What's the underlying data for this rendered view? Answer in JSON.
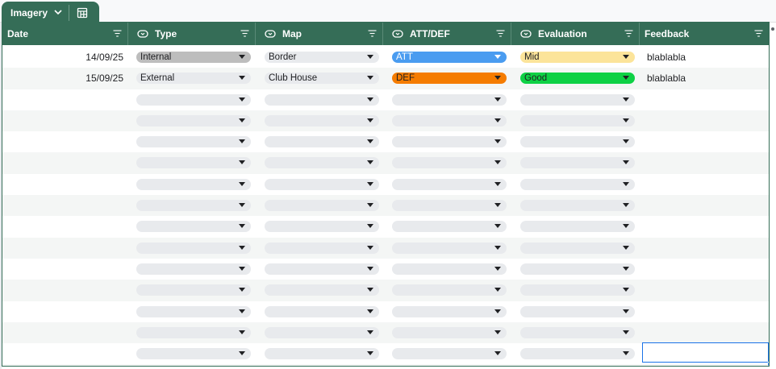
{
  "sheet_tab": {
    "name": "Imagery",
    "chevron_icon": "chevron-down-icon",
    "table_icon": "table-view-icon"
  },
  "colors": {
    "header_bg": "#356d57",
    "chip_default": "#e8eaed",
    "internal": "#bdbdbd",
    "att": "#4a9cf0",
    "def": "#f57c00",
    "mid": "#fce49a",
    "good": "#0ed145",
    "selection": "#1a73e8"
  },
  "columns": [
    {
      "label": "Date",
      "icon": ""
    },
    {
      "label": "Type",
      "icon": "dropdown-chip-icon"
    },
    {
      "label": "Map",
      "icon": "dropdown-chip-icon"
    },
    {
      "label": "ATT/DEF",
      "icon": "dropdown-chip-icon"
    },
    {
      "label": "Evaluation",
      "icon": "dropdown-chip-icon"
    },
    {
      "label": "Feedback",
      "icon": ""
    }
  ],
  "rows": [
    {
      "date": "14/09/25",
      "type": "Internal",
      "map": "Border",
      "attdef": "ATT",
      "evaluation": "Mid",
      "feedback": "blablabla"
    },
    {
      "date": "15/09/25",
      "type": "External",
      "map": "Club House",
      "attdef": "DEF",
      "evaluation": "Good",
      "feedback": "blablabla"
    }
  ],
  "empty_row_count": 14
}
